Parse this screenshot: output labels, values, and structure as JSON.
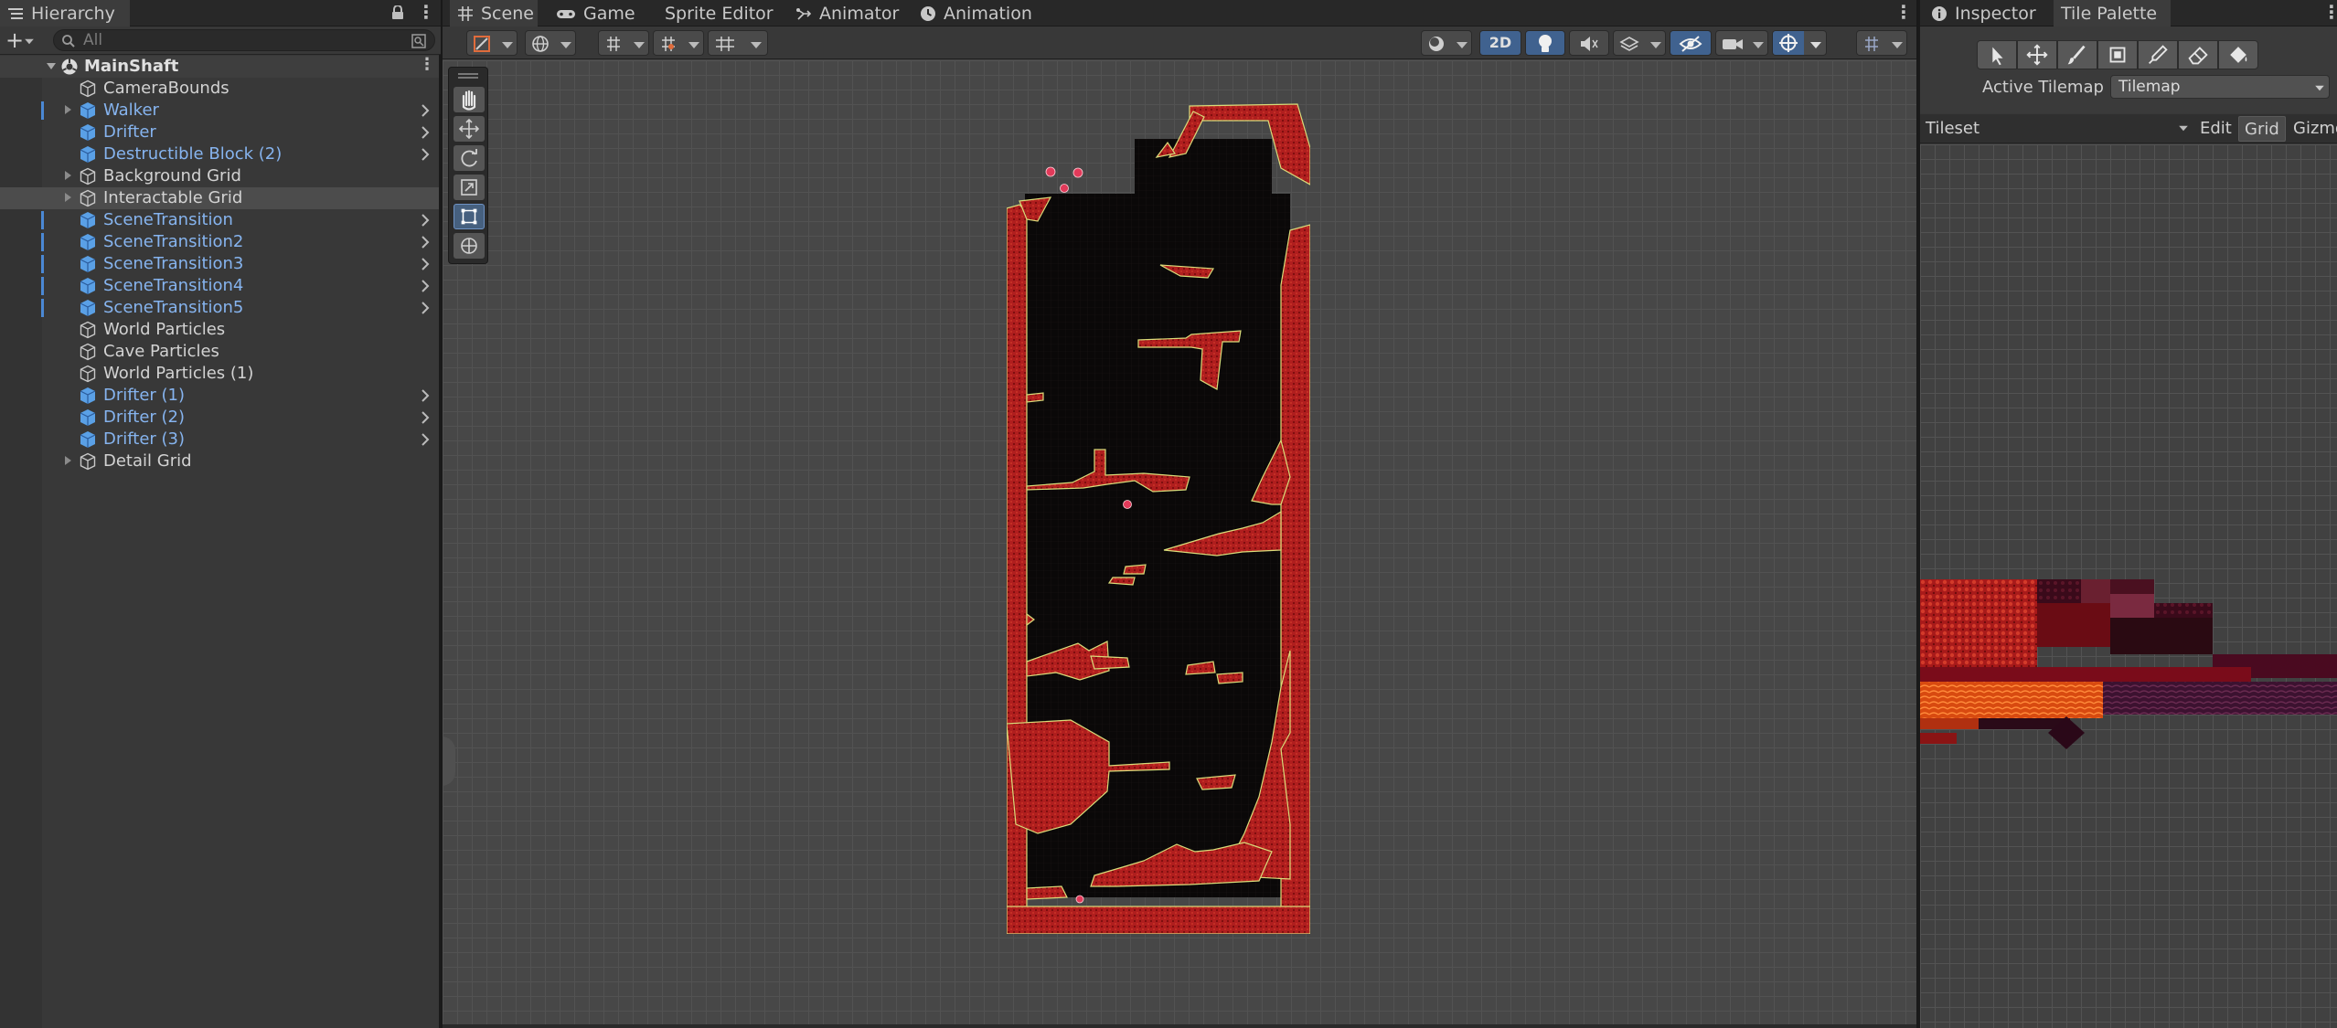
{
  "hierarchy": {
    "tab_label": "Hierarchy",
    "search_placeholder": "All",
    "add_label": "+",
    "scene_name": "MainShaft",
    "items": [
      {
        "label": "CameraBounds",
        "prefab": false,
        "expandable": false
      },
      {
        "label": "Walker",
        "prefab": true,
        "expandable": true
      },
      {
        "label": "Drifter",
        "prefab": true,
        "expandable": false
      },
      {
        "label": "Destructible Block (2)",
        "prefab": true,
        "expandable": false
      },
      {
        "label": "Background Grid",
        "prefab": false,
        "expandable": true
      },
      {
        "label": "Interactable Grid",
        "prefab": false,
        "expandable": true
      },
      {
        "label": "SceneTransition",
        "prefab": true,
        "expandable": false
      },
      {
        "label": "SceneTransition2",
        "prefab": true,
        "expandable": false
      },
      {
        "label": "SceneTransition3",
        "prefab": true,
        "expandable": false
      },
      {
        "label": "SceneTransition4",
        "prefab": true,
        "expandable": false
      },
      {
        "label": "SceneTransition5",
        "prefab": true,
        "expandable": false
      },
      {
        "label": "World Particles",
        "prefab": false,
        "expandable": false
      },
      {
        "label": "Cave Particles",
        "prefab": false,
        "expandable": false
      },
      {
        "label": "World Particles (1)",
        "prefab": false,
        "expandable": false
      },
      {
        "label": "Drifter (1)",
        "prefab": true,
        "expandable": false
      },
      {
        "label": "Drifter (2)",
        "prefab": true,
        "expandable": false
      },
      {
        "label": "Drifter (3)",
        "prefab": true,
        "expandable": false
      },
      {
        "label": "Detail Grid",
        "prefab": false,
        "expandable": true
      }
    ],
    "selected_item": "Interactable Grid"
  },
  "scene_tabs": [
    {
      "label": "Scene",
      "icon": "grid-icon",
      "active": true
    },
    {
      "label": "Game",
      "icon": "gamepad-icon",
      "active": false
    },
    {
      "label": "Sprite Editor",
      "icon": "",
      "active": false
    },
    {
      "label": "Animator",
      "icon": "animator-icon",
      "active": false
    },
    {
      "label": "Animation",
      "icon": "clock-icon",
      "active": false
    }
  ],
  "scene_toolbar": {
    "mode_2d_label": "2D",
    "mode_2d_active": true,
    "lighting_active": true,
    "visibility_active": true,
    "gizmos_active": true
  },
  "scene_tools": [
    "hand-tool",
    "move-tool",
    "rotate-tool",
    "scale-tool",
    "rect-tool",
    "transform-tool"
  ],
  "active_scene_tool": "rect-tool",
  "right_panel": {
    "tabs": [
      {
        "label": "Inspector",
        "icon": "info-icon",
        "active": false
      },
      {
        "label": "Tile Palette",
        "icon": "",
        "active": true
      }
    ],
    "palette_tools": [
      "select-tool",
      "move-tool",
      "paint-brush-tool",
      "box-fill-tool",
      "picker-tool",
      "eraser-tool",
      "fill-bucket-tool"
    ],
    "active_tilemap_label": "Active Tilemap",
    "active_tilemap_value": "Tilemap",
    "palette_name": "Tileset",
    "edit_label": "Edit",
    "grid_label": "Grid",
    "grid_active": true,
    "gizmos_label": "Gizmos"
  },
  "colors": {
    "accent_blue": "#86b4ef",
    "selection_bar": "#4b88d4",
    "tile_red": "#b32121",
    "tile_outline": "#d9dc7a",
    "cave_black": "#0a0808"
  }
}
